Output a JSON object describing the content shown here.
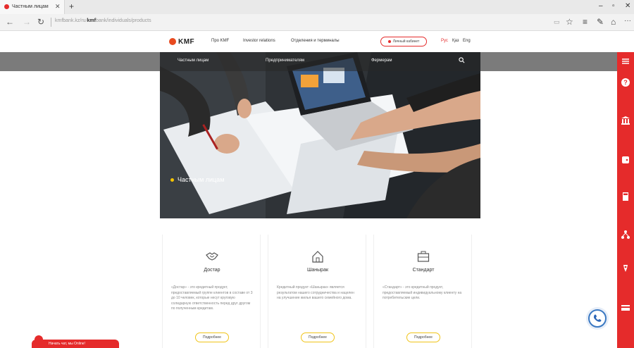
{
  "browser": {
    "tab_title": "Частным лицам",
    "tab_close": "✕",
    "new_tab": "+",
    "url_prefix": "kmfbank.kz/ru/",
    "url_host": "kmf",
    "url_rest": "bank/individuals/products"
  },
  "header": {
    "logo": "KMF",
    "nav": [
      "Про KMF",
      "Investor relations",
      "Отделения и терминалы"
    ],
    "cabinet": "Личный кабинет",
    "langs": [
      "Рус",
      "Қаз",
      "Eng"
    ]
  },
  "subnav": {
    "items": [
      "Частным лицам",
      "Предпринимателям",
      "Фермерам"
    ]
  },
  "hero": {
    "title": "Частным лицам"
  },
  "cards": [
    {
      "title": "Достар",
      "desc": "«Достар» - это кредитный продукт, предоставляемый группе клиентов в составе от 3 до 10 человек, которые несут круговую солидарную ответственность перед друг другом по полученным кредитам.",
      "more": "Подробнее"
    },
    {
      "title": "Шанырак",
      "desc": "Кредитный продукт «Шанырак» является результатом нашего сотрудничества и нацелен на улучшение жилья вашего семейного дома.",
      "more": "Подробнее"
    },
    {
      "title": "Стандарт",
      "desc": "«Стандарт» - это кредитный продукт, предоставляемый индивидуальному клиенту на потребительские цели.",
      "more": "Подробнее"
    }
  ],
  "chat": {
    "label": "Начать чат, мы Online!"
  },
  "colors": {
    "brand_red": "#e52b2b",
    "accent_yellow": "#f0c419",
    "band_gray": "#7b7b7b",
    "phone_blue": "#3a78c2"
  }
}
